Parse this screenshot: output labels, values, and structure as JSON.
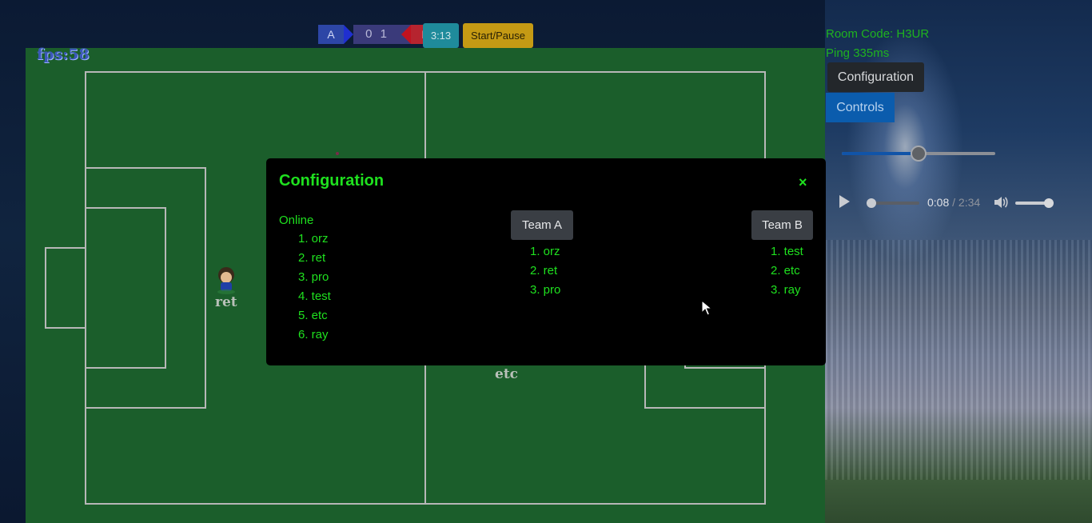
{
  "hud": {
    "fps": "fps:58",
    "team_a_label": "A",
    "score": "0 1",
    "team_b_label": "B",
    "timer": "3:13",
    "start_pause_label": "Start/Pause"
  },
  "room": {
    "code": "Room Code: H3UR",
    "ping": "Ping 335ms"
  },
  "side_buttons": {
    "configuration": "Configuration",
    "controls": "Controls"
  },
  "slider": {
    "value_fraction": 0.5
  },
  "audio": {
    "current": "0:08",
    "separator": " / ",
    "duration": "2:34",
    "progress_fraction": 0.05,
    "volume_fraction": 1.0
  },
  "players_on_field": [
    {
      "name": "ret"
    },
    {
      "name": "etc"
    }
  ],
  "modal": {
    "title": "Configuration",
    "close": "×",
    "online_label": "Online",
    "online": [
      "1. orz",
      "2. ret",
      "3. pro",
      "4. test",
      "5. etc",
      "6. ray"
    ],
    "team_a": {
      "label": "Team A",
      "players": [
        "1. orz",
        "2. ret",
        "3. pro"
      ]
    },
    "team_b": {
      "label": "Team B",
      "players": [
        "1. test",
        "2. etc",
        "3. ray"
      ]
    }
  },
  "colors": {
    "field": "#1b5e2b",
    "accent_green": "#1fe11f",
    "team_a": "#2d46a6",
    "team_b": "#b6242f"
  }
}
